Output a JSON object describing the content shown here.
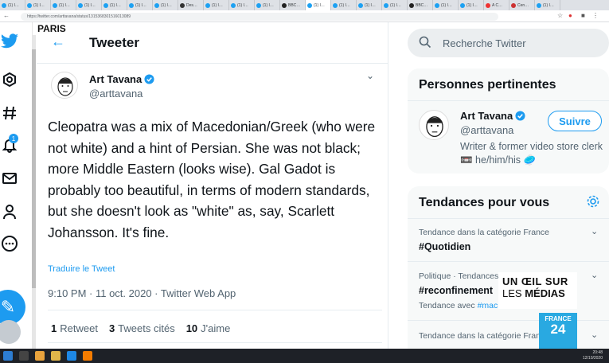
{
  "browser": {
    "tabs": [
      "(1) I…",
      "(1) I…",
      "(1) I…",
      "(1) I…",
      "(1) I…",
      "(1) I…",
      "(1) I…",
      "Des…",
      "(1) I…",
      "(1) I…",
      "(1) I…",
      "BBC…",
      "(1) I…",
      "(1) I…",
      "(1) I…",
      "(1) I…",
      "BBC…",
      "(1) I…",
      "(1) I…",
      "A C…",
      "Cen…",
      "(1) I…"
    ],
    "url": "https://twitter.com/arttavana/status/1315368301516013089"
  },
  "overlay": {
    "city": "PARIS",
    "show_line1": "UN ŒIL SUR",
    "show_line2a": "LES ",
    "show_line2b": "MÉDIAS",
    "channel_small": "FRANCE",
    "channel_big": "24"
  },
  "sidebar": {
    "notif_count": "1"
  },
  "main": {
    "title": "Tweeter",
    "tweet": {
      "name": "Art Tavana",
      "handle": "@arttavana",
      "text": "Cleopatra was a mix of Macedonian/Greek (who were not white) and a hint of Persian. She was not black; more Middle Eastern (looks wise). Gal Gadot is probably too beautiful, in terms of modern standards, but she doesn't look as \"white\" as, say, Scarlett Johansson. It's fine.",
      "translate": "Traduire le Tweet",
      "meta": "9:10 PM · 11 oct. 2020 · Twitter Web App",
      "retweets_count": "1",
      "retweets_label": "Retweet",
      "quotes_count": "3",
      "quotes_label": "Tweets cités",
      "likes_count": "10",
      "likes_label": "J'aime"
    }
  },
  "right": {
    "search_placeholder": "Recherche Twitter",
    "relevant": {
      "title": "Personnes pertinentes",
      "name": "Art Tavana",
      "handle": "@arttavana",
      "follow_label": "Suivre",
      "bio": "Writer & former video store clerk 📼 he/him/his 🥏"
    },
    "trends": {
      "title": "Tendances pour vous",
      "items": [
        {
          "category": "Tendance dans la catégorie France",
          "name": "#Quotidien",
          "extra": "",
          "extra_link": ""
        },
        {
          "category": "Politique · Tendances",
          "name": "#reconfinement",
          "extra": "Tendance avec ",
          "extra_link": "#macronzon"
        },
        {
          "category": "Tendance dans la catégorie France",
          "name": "",
          "extra": "",
          "extra_link": ""
        }
      ]
    }
  },
  "taskbar": {
    "time": "20:48",
    "date": "12/10/2020"
  },
  "colors": {
    "accent": "#1d9bf0",
    "france24": "#29a9e1"
  }
}
